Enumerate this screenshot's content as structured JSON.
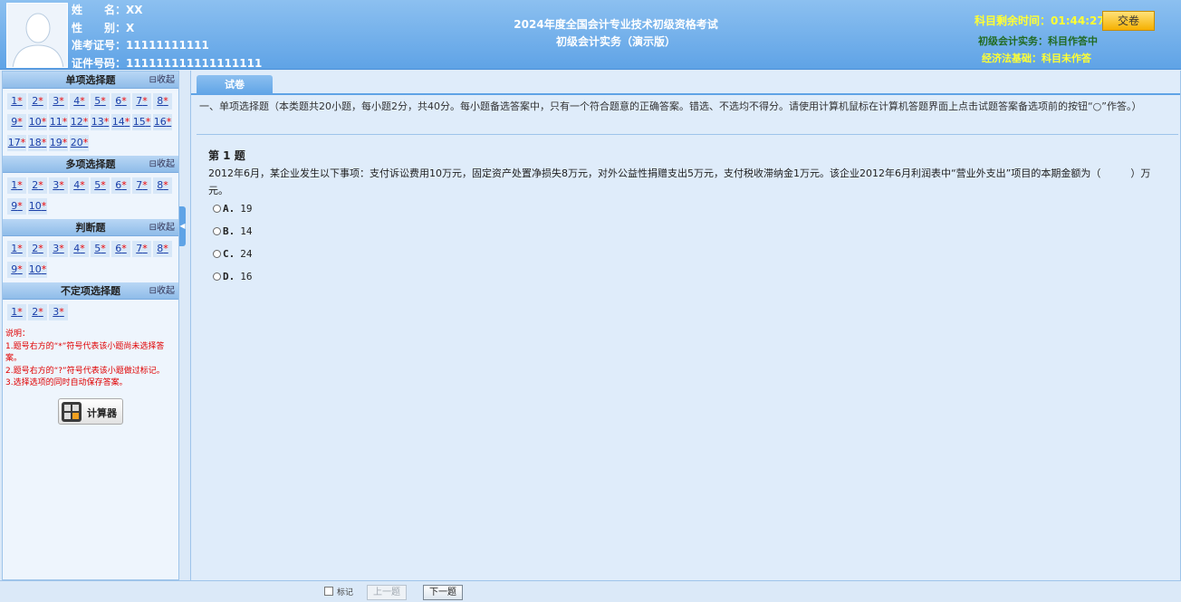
{
  "candidate": {
    "name_label": "姓　　名：",
    "name": "XX",
    "gender_label": "性　　别：",
    "gender": "X",
    "exam_no_label": "准考证号：",
    "exam_no": "11111111111",
    "id_no_label": "证件号码：",
    "id_no": "111111111111111111"
  },
  "exam": {
    "title": "2024年度全国会计专业技术初级资格考试",
    "subtitle": "初级会计实务（演示版）"
  },
  "timer": {
    "label": "科目剩余时间：",
    "value": "01:44:27"
  },
  "submit_label": "交卷",
  "subjects": [
    {
      "name": "初级会计实务",
      "status": "：科目作答中"
    },
    {
      "name": "经济法基础",
      "status": "：科目未作答"
    }
  ],
  "sections": [
    {
      "title": "单项选择题",
      "fold": "⊟收起",
      "count": 20
    },
    {
      "title": "多项选择题",
      "fold": "⊟收起",
      "count": 10
    },
    {
      "title": "判断题",
      "fold": "⊟收起",
      "count": 10
    },
    {
      "title": "不定项选择题",
      "fold": "⊟收起",
      "count": 3
    }
  ],
  "unanswered_mark": "*",
  "notes": [
    "说明：",
    "1.题号右方的“*”符号代表该小题尚未选择答案。",
    "2.题号右方的“?”符号代表该小题做过标记。",
    "3.选择选项的同时自动保存答案。"
  ],
  "calculator_label": "计算器",
  "tab_label": "试卷",
  "instruction": "一、单项选择题（本类题共20小题，每小题2分，共40分。每小题备选答案中，只有一个符合题意的正确答案。错选、不选均不得分。请使用计算机鼠标在计算机答题界面上点击试题答案备选项前的按钮“○”作答。）",
  "question": {
    "title": "第 1 题",
    "text": "2012年6月，某企业发生以下事项：支付诉讼费用10万元，固定资产处置净损失8万元，对外公益性捐赠支出5万元，支付税收滞纳金1万元。该企业2012年6月利润表中“营业外支出”项目的本期金额为（　　　）万元。",
    "options": [
      {
        "key": "A.",
        "value": "19"
      },
      {
        "key": "B.",
        "value": "14"
      },
      {
        "key": "C.",
        "value": "24"
      },
      {
        "key": "D.",
        "value": "16"
      }
    ]
  },
  "footer": {
    "mark_label": "标记",
    "prev_label": "上一题",
    "next_label": "下一题"
  }
}
